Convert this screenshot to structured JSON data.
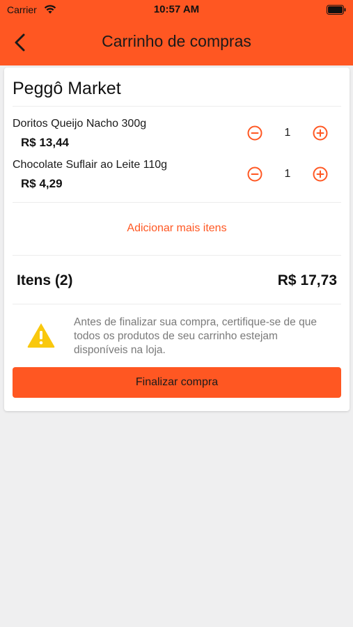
{
  "status_bar": {
    "carrier": "Carrier",
    "time": "10:57 AM"
  },
  "header": {
    "title": "Carrinho de compras",
    "back_icon": "chevron-left-icon"
  },
  "cart": {
    "store_name": "Peggô Market",
    "items": [
      {
        "name": "Doritos Queijo Nacho 300g",
        "price": "R$ 13,44",
        "quantity": "1"
      },
      {
        "name": "Chocolate Suflair ao Leite 110g",
        "price": "R$ 4,29",
        "quantity": "1"
      }
    ],
    "add_more_label": "Adicionar mais itens",
    "total_label": "Itens (2)",
    "total_value": "R$ 17,73",
    "warning_text": "Antes de finalizar sua compra, certifique-se de que todos os produtos de seu carrinho estejam disponíveis na loja.",
    "finish_label": "Finalizar compra"
  },
  "colors": {
    "accent": "#ff5722",
    "warning": "#f9c80e",
    "background": "#efeff0"
  }
}
